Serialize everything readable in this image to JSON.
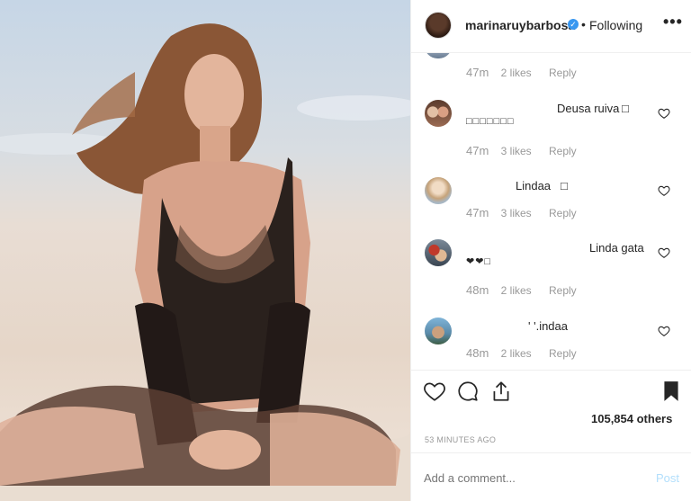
{
  "header": {
    "username": "marinaruybarbosa",
    "separator": "•",
    "follow_status": "Following",
    "more_label": "•••"
  },
  "comments": {
    "top_partial": {
      "time": "47m",
      "likes": "2 likes",
      "reply": "Reply"
    },
    "items": [
      {
        "author": "Deusa ruiva",
        "text_suffix": "□",
        "text_line2": "□□□□□□□",
        "time": "47m",
        "likes": "3 likes",
        "reply": "Reply"
      },
      {
        "author": "Lindaa",
        "text_suffix": "□",
        "text_line2": "",
        "time": "47m",
        "likes": "3 likes",
        "reply": "Reply"
      },
      {
        "author": "Linda gata",
        "text_suffix": "",
        "text_line2": "❤❤□",
        "time": "48m",
        "likes": "2 likes",
        "reply": "Reply"
      },
      {
        "author": "' '.indaa",
        "text_suffix": "",
        "text_line2": "",
        "time": "48m",
        "likes": "2 likes",
        "reply": "Reply"
      }
    ]
  },
  "actions": {
    "like_count": "105,854 others",
    "time_ago": "53 MINUTES AGO"
  },
  "add_comment": {
    "placeholder": "Add a comment...",
    "post_label": "Post"
  },
  "colors": {
    "verified": "#3897f0",
    "muted": "#999999",
    "post_disabled": "#b2dffc",
    "text": "#262626"
  }
}
